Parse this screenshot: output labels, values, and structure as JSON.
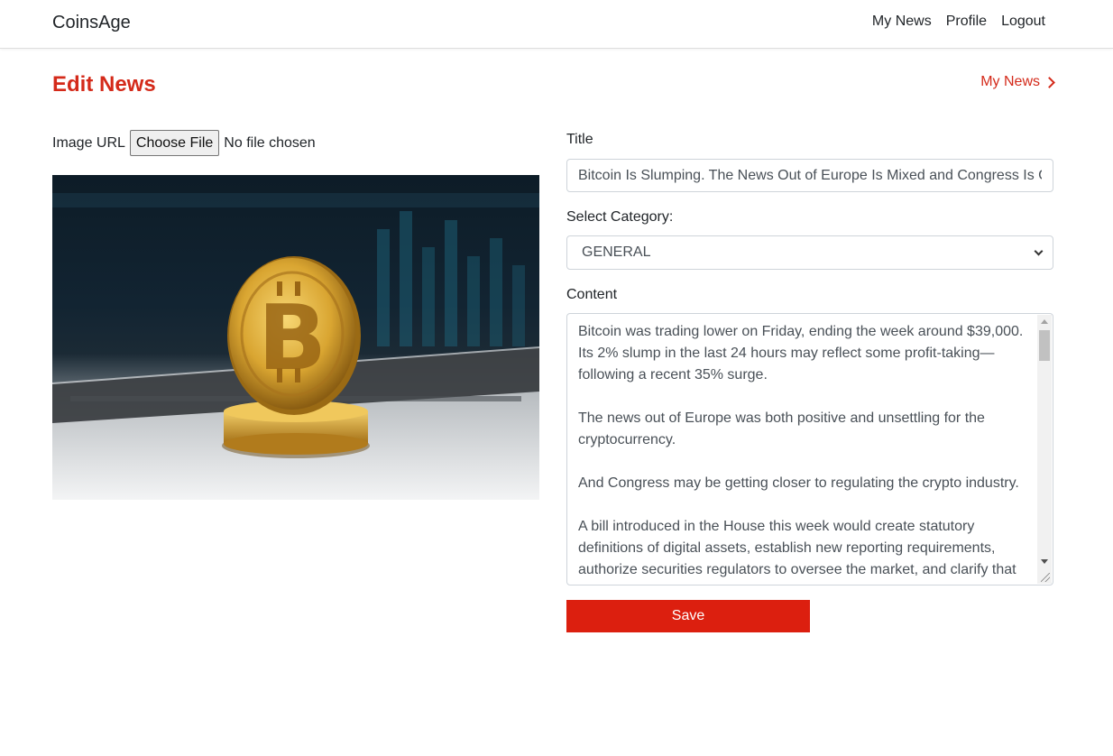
{
  "navbar": {
    "brand": "CoinsAge",
    "links": [
      "My News",
      "Profile",
      "Logout"
    ]
  },
  "header": {
    "title": "Edit News",
    "back_link": "My News"
  },
  "image_upload": {
    "label": "Image URL",
    "button": "Choose File",
    "status": "No file chosen"
  },
  "form": {
    "title_label": "Title",
    "title_value": "Bitcoin Is Slumping. The News Out of Europe Is Mixed and Congress Is Ci",
    "category_label": "Select Category:",
    "category_value": "GENERAL",
    "content_label": "Content",
    "content_paragraphs": [
      "Bitcoin was trading lower on Friday, ending the week around $39,000. Its 2% slump in the last 24 hours may reflect some profit-taking—following a recent 35% surge.",
      "The news out of Europe was both positive and unsettling for the cryptocurrency.",
      "And Congress may be getting closer to regulating the crypto industry.",
      "A bill introduced in the House this week would create statutory definitions of digital assets, establish new reporting requirements, authorize securities regulators to oversee the market, and clarify that"
    ],
    "save_label": "Save"
  },
  "colors": {
    "accent": "#d42a1a",
    "save_button": "#dc1f0f"
  }
}
